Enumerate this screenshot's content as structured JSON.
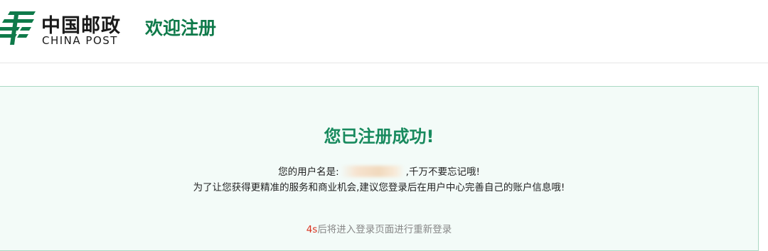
{
  "header": {
    "logo_cn": "中国邮政",
    "logo_en": "CHINA POST",
    "page_title": "欢迎注册"
  },
  "result": {
    "title": "您已注册成功!",
    "username_prefix": "您的用户名是:",
    "username_suffix": ",千万不要忘记哦!",
    "message": "为了让您获得更精准的服务和商业机会,建议您登录后在用户中心完善自己的账户信息哦!",
    "countdown": "4s",
    "redirect_text": "后将进入登录页面进行重新登录"
  },
  "colors": {
    "brand_green": "#0f7a4a",
    "success_green": "#188a5e",
    "countdown_red": "#d9311e",
    "panel_bg": "#f3fbf8",
    "panel_border": "#a9d9c3"
  },
  "icons": {
    "logo": "china-post-logo-icon"
  }
}
